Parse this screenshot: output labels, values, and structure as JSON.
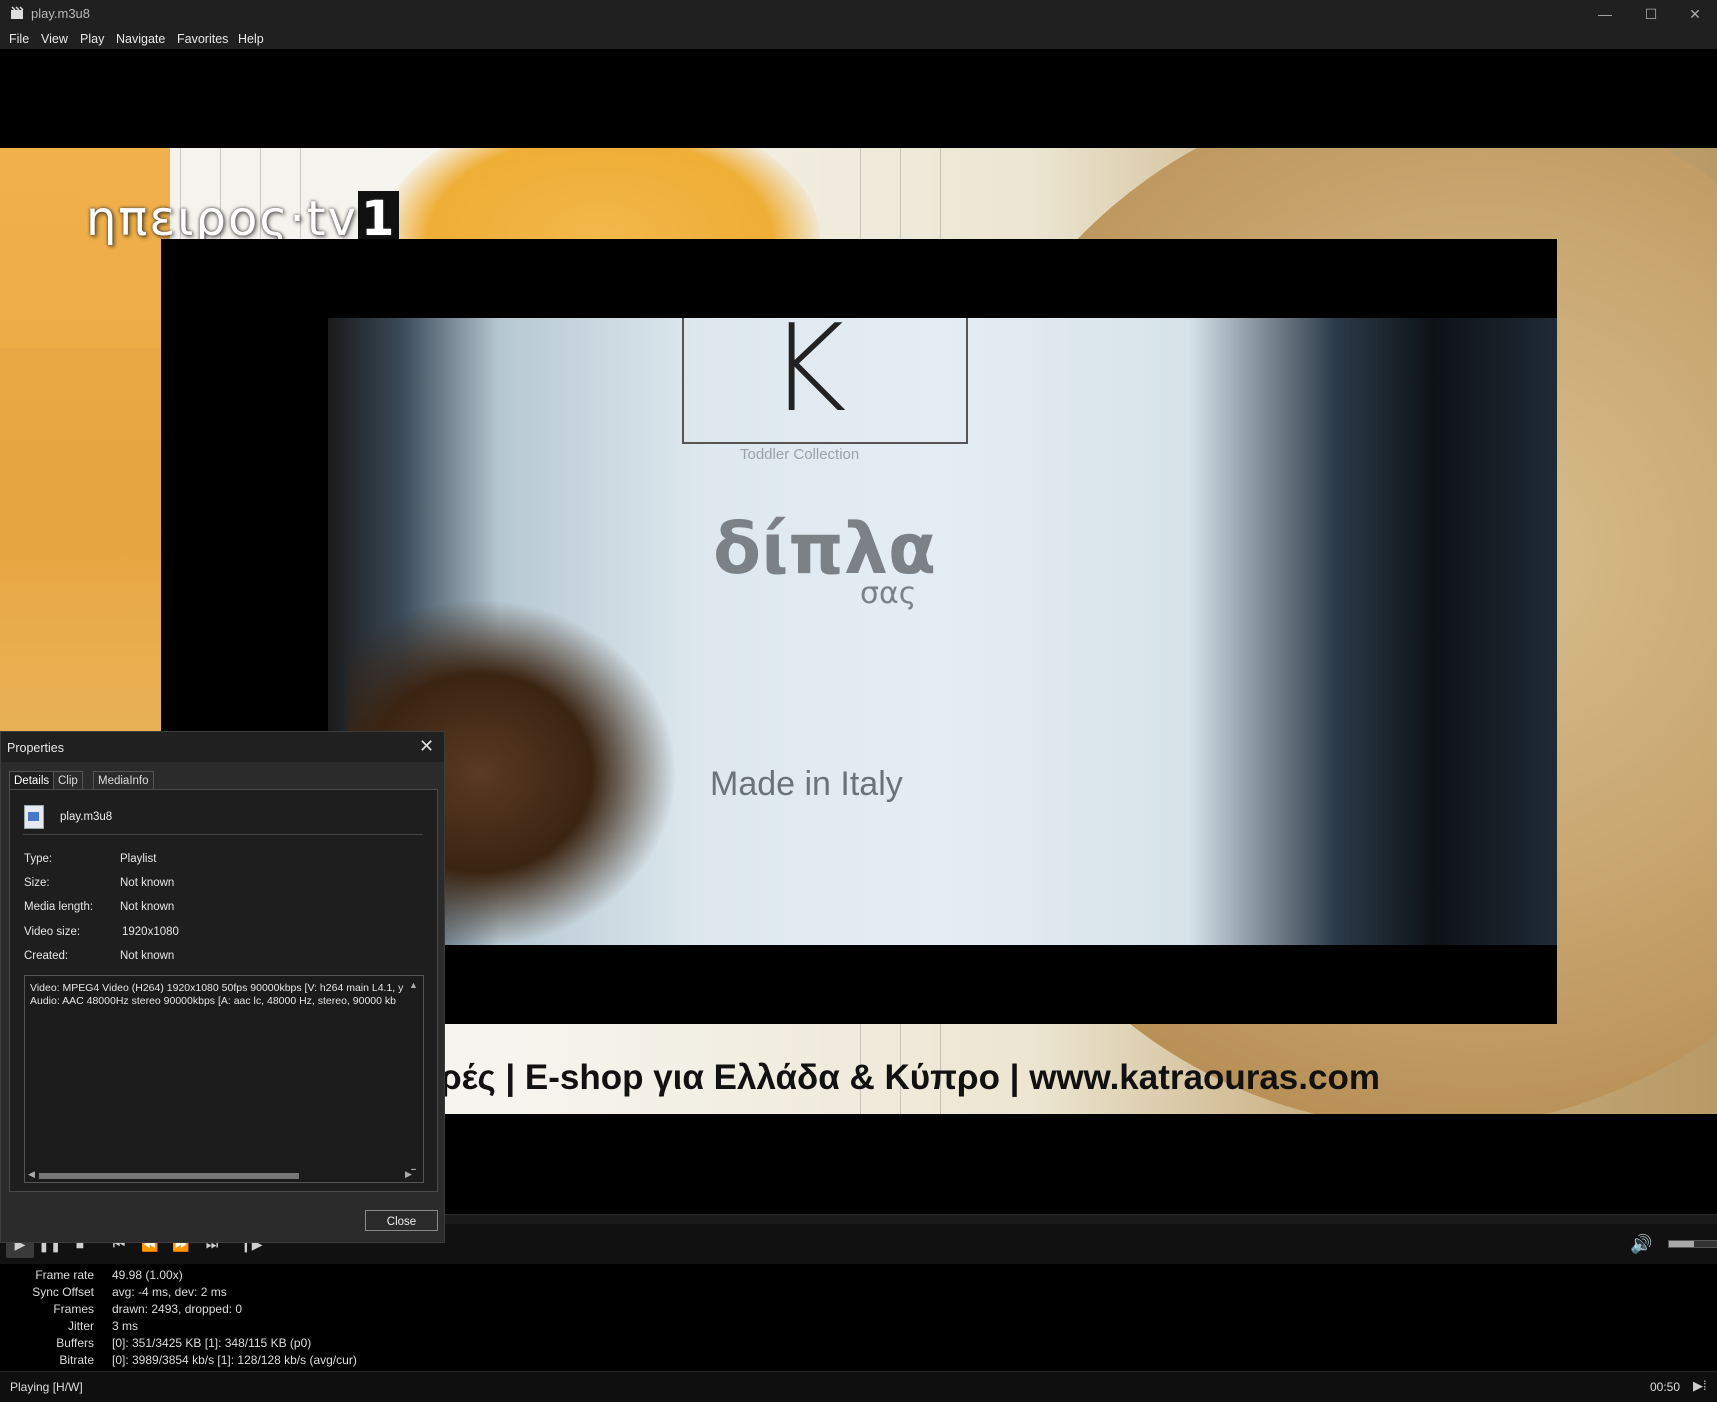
{
  "window": {
    "title": "play.m3u8",
    "minimize_icon": "minimize-icon",
    "maximize_icon": "maximize-icon",
    "close_icon": "close-icon"
  },
  "menu": [
    "File",
    "View",
    "Play",
    "Navigate",
    "Favorites",
    "Help"
  ],
  "video": {
    "channel_logo_text": "ηπειρος·tv",
    "channel_logo_num": "1",
    "k_letter": "K",
    "tagline": "Toddler Collection",
    "brand_main": "δίπλα",
    "brand_sub": "σας",
    "made_in": "Made in Italy",
    "ticker": "ρές | E-shop για Ελλάδα & Κύπρο | www.katraouras.com"
  },
  "controls": {
    "play_icon": "play-icon",
    "pause_icon": "pause-icon",
    "stop_icon": "stop-icon",
    "prev_icon": "skip-back-icon",
    "rewind_icon": "rewind-icon",
    "forward_icon": "fast-forward-icon",
    "next_icon": "skip-forward-icon",
    "frame_step_icon": "frame-step-icon",
    "volume_icon": "volume-icon",
    "volume_level": 0.5
  },
  "stats": [
    {
      "label": "Frame rate",
      "value": "49.98 (1.00x)"
    },
    {
      "label": "Sync Offset",
      "value": "avg: -4 ms, dev: 2 ms"
    },
    {
      "label": "Frames",
      "value": "drawn: 2493, dropped: 0"
    },
    {
      "label": "Jitter",
      "value": "3 ms"
    },
    {
      "label": "Buffers",
      "value": "[0]: 351/3425 KB [1]: 348/115 KB (p0)"
    },
    {
      "label": "Bitrate",
      "value": "[0]: 3989/3854 kb/s [1]: 128/128 kb/s (avg/cur)"
    }
  ],
  "status": {
    "text": "Playing [H/W]",
    "time": "00:50"
  },
  "properties": {
    "title": "Properties",
    "tabs": [
      "Details",
      "Clip",
      "MediaInfo"
    ],
    "file_name": "play.m3u8",
    "rows": [
      {
        "label": "Type:",
        "value": "Playlist"
      },
      {
        "label": "Size:",
        "value": "Not known"
      },
      {
        "label": "Media length:",
        "value": "Not known"
      },
      {
        "label": "Video size:",
        "value": "1920x1080"
      },
      {
        "label": "Created:",
        "value": "Not known"
      }
    ],
    "info_lines": [
      "Video: MPEG4 Video (H264) 1920x1080 50fps 90000kbps [V: h264 main L4.1, y",
      "Audio: AAC 48000Hz stereo 90000kbps [A: aac lc, 48000 Hz, stereo, 90000 kb"
    ],
    "close_label": "Close"
  }
}
